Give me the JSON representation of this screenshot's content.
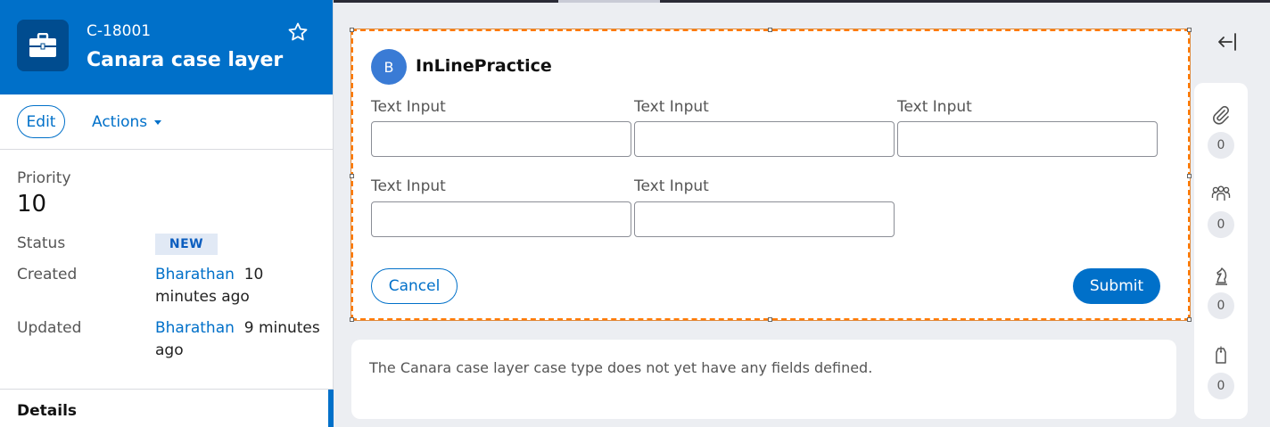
{
  "case": {
    "id": "C-18001",
    "title": "Canara case layer"
  },
  "actions": {
    "edit_label": "Edit",
    "actions_label": "Actions"
  },
  "summary": {
    "priority_label": "Priority",
    "priority_value": "10",
    "status_label": "Status",
    "status_value": "NEW",
    "created_label": "Created",
    "created_by": "Bharathan",
    "created_time_1": "10",
    "created_time_2": "minutes ago",
    "updated_label": "Updated",
    "updated_by": "Bharathan",
    "updated_time_1": "9 minutes",
    "updated_time_2": "ago"
  },
  "tabs": {
    "details": "Details"
  },
  "form": {
    "avatar_letter": "B",
    "title": "InLinePractice",
    "fields": [
      {
        "label": "Text Input",
        "value": ""
      },
      {
        "label": "Text Input",
        "value": ""
      },
      {
        "label": "Text Input",
        "value": ""
      },
      {
        "label": "Text Input",
        "value": ""
      },
      {
        "label": "Text Input",
        "value": ""
      }
    ],
    "cancel_label": "Cancel",
    "submit_label": "Submit"
  },
  "info": {
    "message": "The Canara case layer case type does not yet have any fields defined."
  },
  "utilities": {
    "attachments_count": "0",
    "followers_count": "0",
    "stakeholders_count": "0",
    "tags_count": "0"
  },
  "colors": {
    "brand": "#0070c9",
    "badge_bg": "#e1e9f5",
    "selection_outline": "#ff7a00"
  }
}
